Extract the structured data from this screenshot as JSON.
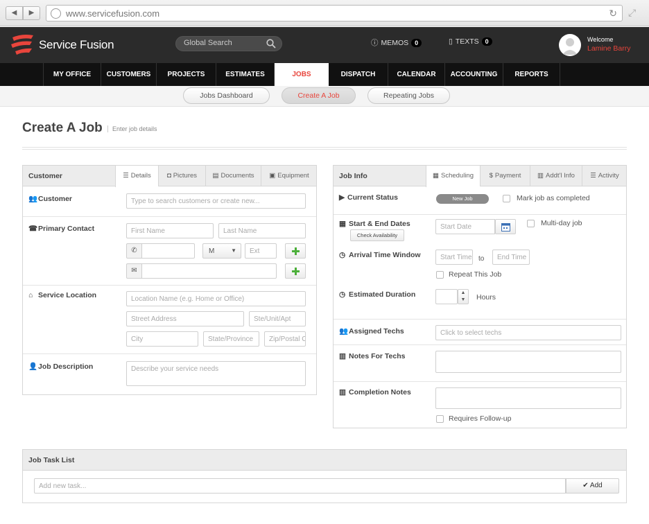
{
  "browser": {
    "url": "www.servicefusion.com"
  },
  "header": {
    "logo_text": "Service Fusion",
    "search_placeholder": "Global Search",
    "memos_label": "MEMOS",
    "memos_count": "0",
    "texts_label": "TEXTS",
    "texts_count": "0",
    "welcome_label": "Welcome",
    "user_name": "Lamine Barry"
  },
  "nav": {
    "items": [
      {
        "label": "MY OFFICE"
      },
      {
        "label": "CUSTOMERS"
      },
      {
        "label": "PROJECTS"
      },
      {
        "label": "ESTIMATES"
      },
      {
        "label": "JOBS"
      },
      {
        "label": "DISPATCH"
      },
      {
        "label": "CALENDAR"
      },
      {
        "label": "ACCOUNTING"
      },
      {
        "label": "REPORTS"
      }
    ],
    "active": "JOBS"
  },
  "subnav": {
    "items": [
      {
        "label": "Jobs Dashboard"
      },
      {
        "label": "Create A Job"
      },
      {
        "label": "Repeating Jobs"
      }
    ]
  },
  "page": {
    "title": "Create A Job",
    "subtitle": "Enter job details"
  },
  "customer_panel": {
    "title": "Customer",
    "tabs": [
      {
        "label": "Details"
      },
      {
        "label": "Pictures"
      },
      {
        "label": "Documents"
      },
      {
        "label": "Equipment"
      }
    ],
    "customer_label": "Customer",
    "customer_placeholder": "Type to search customers or create new...",
    "contact_label": "Primary Contact",
    "first_name_placeholder": "First Name",
    "last_name_placeholder": "Last Name",
    "phone_type": "M",
    "ext_placeholder": "Ext",
    "location_label": "Service Location",
    "location_name_placeholder": "Location Name (e.g. Home or Office)",
    "street_placeholder": "Street Address",
    "unit_placeholder": "Ste/Unit/Apt",
    "city_placeholder": "City",
    "state_placeholder": "State/Province",
    "zip_placeholder": "Zip/Postal C",
    "description_label": "Job Description",
    "description_placeholder": "Describe your service needs"
  },
  "jobinfo_panel": {
    "title": "Job Info",
    "tabs": [
      {
        "label": "Scheduling"
      },
      {
        "label": "Payment"
      },
      {
        "label": "Addt'l Info"
      },
      {
        "label": "Activity"
      }
    ],
    "status_label": "Current Status",
    "status_value": "New Job",
    "mark_completed_label": "Mark job as completed",
    "dates_label": "Start & End Dates",
    "check_availability": "Check Availability",
    "start_date_placeholder": "Start Date",
    "multiday_label": "Multi-day job",
    "arrival_label": "Arrival Time Window",
    "start_time_placeholder": "Start Time",
    "to_label": "to",
    "end_time_placeholder": "End Time",
    "repeat_label": "Repeat This Job",
    "duration_label": "Estimated Duration",
    "hours_label": "Hours",
    "techs_label": "Assigned Techs",
    "techs_placeholder": "Click to select techs",
    "notes_techs_label": "Notes For Techs",
    "completion_notes_label": "Completion Notes",
    "followup_label": "Requires Follow-up"
  },
  "task_panel": {
    "title": "Job Task List",
    "input_placeholder": "Add new task...",
    "add_label": "Add"
  },
  "colors": {
    "brand_red": "#e8453c",
    "header_dark": "#2b2b2b",
    "nav_black": "#111111"
  }
}
